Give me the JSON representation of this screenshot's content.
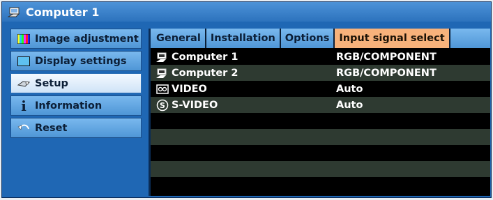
{
  "window": {
    "title": "Computer 1",
    "title_icon": "computer-icon"
  },
  "sidebar": {
    "items": [
      {
        "label": "Image adjustment",
        "icon": "color-bars-icon",
        "active": false
      },
      {
        "label": "Display settings",
        "icon": "display-icon",
        "active": false
      },
      {
        "label": "Setup",
        "icon": "setup-icon",
        "active": true
      },
      {
        "label": "Information",
        "icon": "info-icon",
        "active": false
      },
      {
        "label": "Reset",
        "icon": "reset-arrow-icon",
        "active": false
      }
    ]
  },
  "tabs": [
    {
      "label": "General",
      "active": false
    },
    {
      "label": "Installation",
      "active": false
    },
    {
      "label": "Options",
      "active": false
    },
    {
      "label": "Input signal select",
      "active": true
    }
  ],
  "inputs": [
    {
      "name": "Computer 1",
      "value": "RGB/COMPONENT",
      "icon": "computer-1-icon"
    },
    {
      "name": "Computer 2",
      "value": "RGB/COMPONENT",
      "icon": "computer-2-icon"
    },
    {
      "name": "VIDEO",
      "value": "Auto",
      "icon": "video-icon"
    },
    {
      "name": "S-VIDEO",
      "value": "Auto",
      "icon": "s-video-icon"
    }
  ],
  "colors": {
    "frame": "#1f67b4",
    "menu_item": "#5fa3e0",
    "active_tab": "#f7b27b",
    "row_dark": "#000000",
    "row_light": "#2e3a31"
  }
}
